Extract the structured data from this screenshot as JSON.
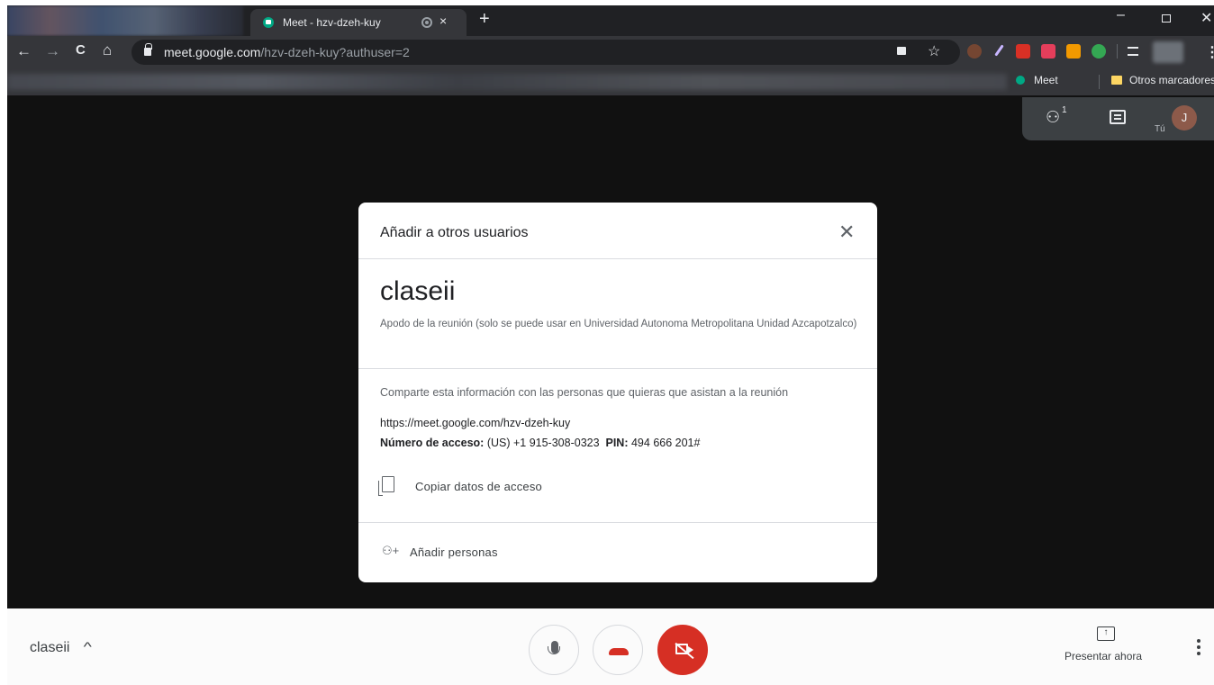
{
  "browser": {
    "active_tab_title": "Meet - hzv-dzeh-kuy",
    "tab_close": "×",
    "new_tab": "+",
    "url_domain": "meet.google.com",
    "url_path": "/hzv-dzeh-kuy?authuser=2",
    "nav": {
      "back": "←",
      "forward": "→",
      "reload": "C",
      "home": "⌂"
    },
    "window": {
      "minimize": "–",
      "close": "✕"
    },
    "bookmarks": {
      "meet": "Meet",
      "otros": "Otros marcadores"
    }
  },
  "meet_panel": {
    "people_count": "1",
    "you_label": "Tú",
    "self_initial": "J"
  },
  "dialog": {
    "title": "Añadir a otros usuarios",
    "close": "✕",
    "meeting_name": "claseii",
    "nickname_desc": "Apodo de la reunión (solo se puede usar en Universidad Autonoma Metropolitana Unidad Azcapotzalco)",
    "share_text": "Comparte esta información con las personas que quieras que asistan a la reunión",
    "meet_link": "https://meet.google.com/hzv-dzeh-kuy",
    "access_label": "Número de acceso:",
    "access_number": "(US) +1 915-308-0323",
    "pin_label": "PIN:",
    "pin_value": "494 666 201#",
    "copy_label": "Copiar datos de acceso",
    "add_people_label": "Añadir personas"
  },
  "controls": {
    "meeting_name": "claseii",
    "caret": "^",
    "present_label": "Presentar ahora",
    "present_icon": "↑"
  },
  "icons": {
    "favicon": "meet-favicon-icon",
    "camera_off": "camera-off-icon",
    "hangup": "phone-hangup-icon",
    "mic": "microphone-icon"
  },
  "colors": {
    "accent_red": "#d93025",
    "meet_green": "#00a884",
    "dark_bg": "#111111"
  }
}
